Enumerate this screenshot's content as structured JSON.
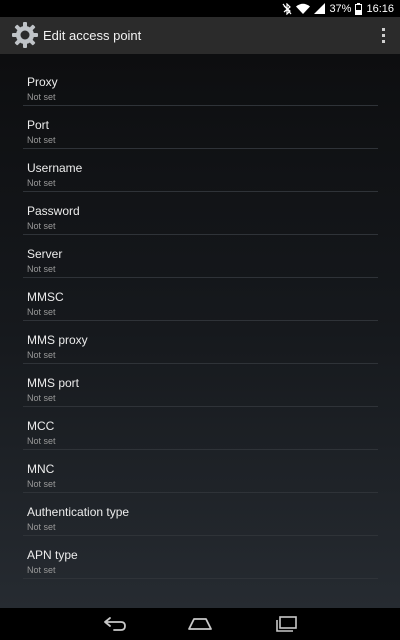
{
  "status_bar": {
    "battery_percent": "37%",
    "time": "16:16",
    "icons": [
      "bluetooth-off-icon",
      "wifi-icon",
      "signal-icon",
      "battery-icon"
    ]
  },
  "action_bar": {
    "title": "Edit access point",
    "app_icon": "settings-gear-icon",
    "overflow_icon": "overflow-menu-icon"
  },
  "preferences": [
    {
      "title": "Proxy",
      "summary": "Not set"
    },
    {
      "title": "Port",
      "summary": "Not set"
    },
    {
      "title": "Username",
      "summary": "Not set"
    },
    {
      "title": "Password",
      "summary": "Not set"
    },
    {
      "title": "Server",
      "summary": "Not set"
    },
    {
      "title": "MMSC",
      "summary": "Not set"
    },
    {
      "title": "MMS proxy",
      "summary": "Not set"
    },
    {
      "title": "MMS port",
      "summary": "Not set"
    },
    {
      "title": "MCC",
      "summary": "Not set"
    },
    {
      "title": "MNC",
      "summary": "Not set"
    },
    {
      "title": "Authentication type",
      "summary": "Not set"
    },
    {
      "title": "APN type",
      "summary": "Not set"
    }
  ],
  "nav_bar": {
    "icons": [
      "back-icon",
      "home-icon",
      "recents-icon"
    ]
  }
}
